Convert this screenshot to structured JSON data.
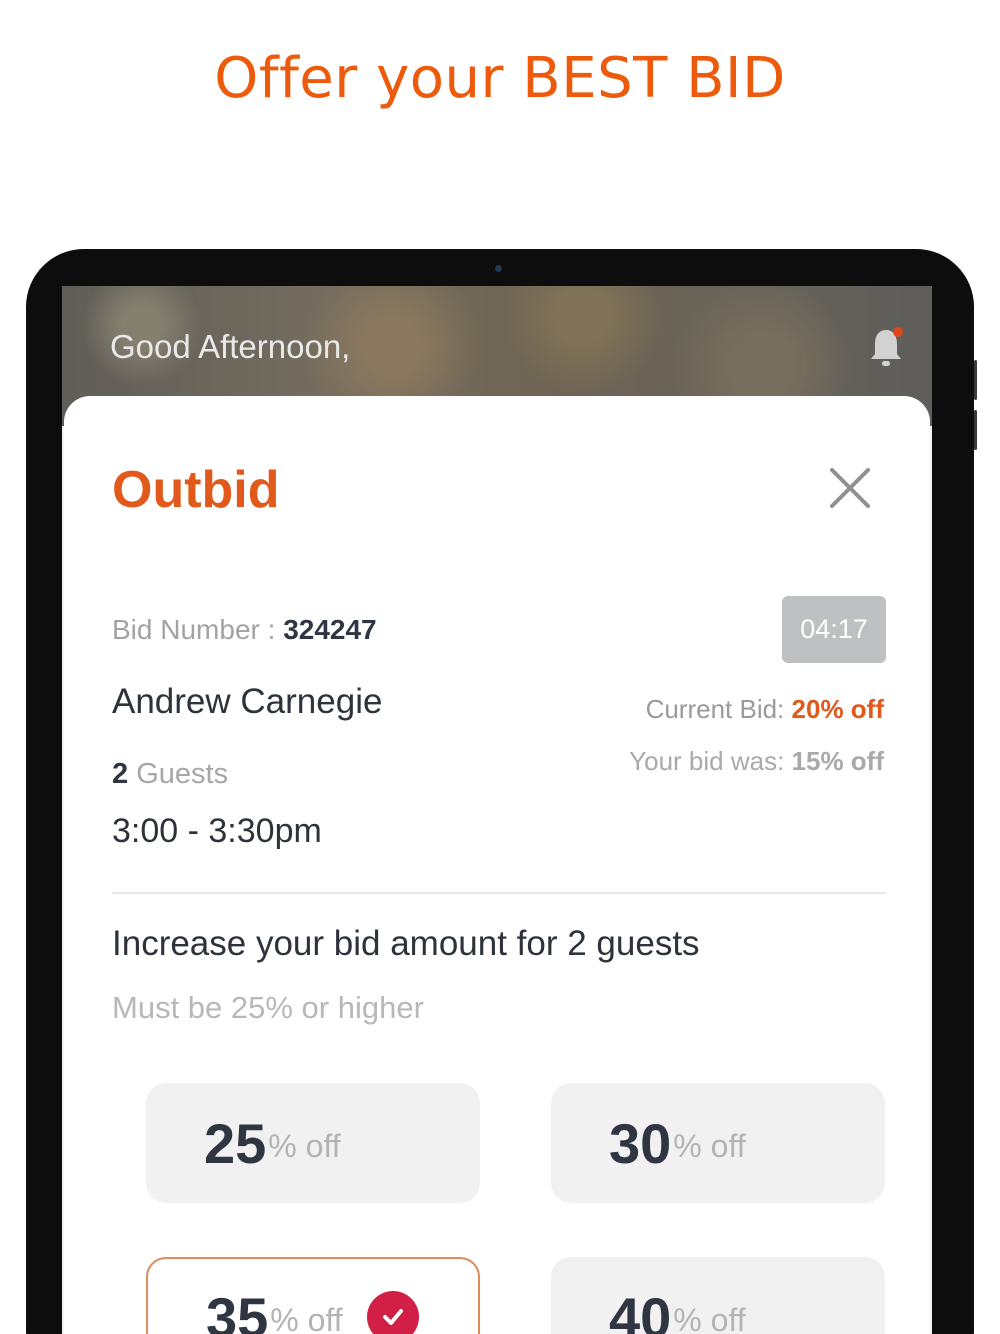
{
  "headline": "Offer your BEST BID",
  "screen": {
    "greeting": "Good Afternoon,",
    "icons": {
      "bell": "bell-icon",
      "close": "close-icon",
      "check": "check-icon"
    }
  },
  "modal": {
    "title": "Outbid",
    "bid_number_label": "Bid Number :",
    "bid_number": "324247",
    "timer": "04:17",
    "customer_name": "Andrew Carnegie",
    "current_bid_label": "Current Bid:",
    "current_bid_value": "20% off",
    "your_bid_label": "Your bid was:",
    "your_bid_value": "15% off",
    "guests_count": "2",
    "guests_label": "Guests",
    "time_slot": "3:00 - 3:30pm",
    "increase_text": "Increase your bid amount for 2 guests",
    "min_text": "Must be 25% or higher",
    "options": [
      {
        "value": "25",
        "suffix": "% off",
        "selected": false
      },
      {
        "value": "30",
        "suffix": "% off",
        "selected": false
      },
      {
        "value": "35",
        "suffix": "% off",
        "selected": true
      },
      {
        "value": "40",
        "suffix": "% off",
        "selected": false
      }
    ]
  },
  "colors": {
    "accent": "#e15a1b",
    "headline": "#ee5a0c",
    "selected_check": "#d11f46",
    "timer_bg": "#bfc0c2"
  }
}
